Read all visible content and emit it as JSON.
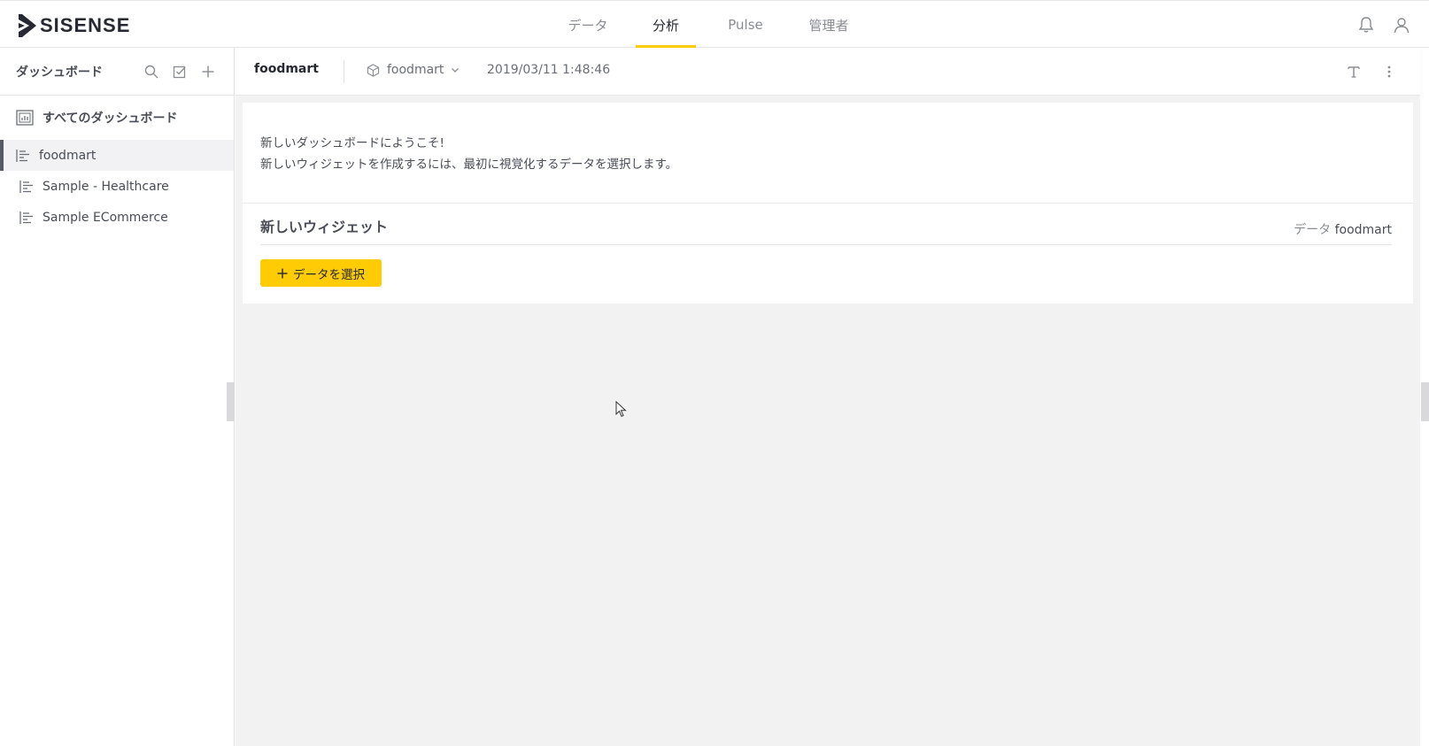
{
  "app": {
    "logo_text": "SISENSE"
  },
  "topnav": {
    "tabs": [
      {
        "label": "データ"
      },
      {
        "label": "分析",
        "active": true
      },
      {
        "label": "Pulse"
      },
      {
        "label": "管理者"
      }
    ]
  },
  "top_icons": [
    "bell-icon",
    "user-icon"
  ],
  "sidebar": {
    "title": "ダッシュボード",
    "tools": [
      "search-icon",
      "checklist-icon",
      "plus-icon"
    ],
    "all_label": "すべてのダッシュボード",
    "items": [
      {
        "label": "foodmart",
        "active": true
      },
      {
        "label": "Sample - Healthcare"
      },
      {
        "label": "Sample ECommerce"
      }
    ]
  },
  "dashboard": {
    "name": "foodmart",
    "source": "foodmart",
    "timestamp": "2019/03/11 1:48:46",
    "right_icons": [
      "text-icon",
      "more-icon"
    ]
  },
  "welcome": {
    "line1": "新しいダッシュボードにようこそ!",
    "line2": "新しいウィジェットを作成するには、最初に視覚化するデータを選択します。"
  },
  "new_widget": {
    "title": "新しいウィジェット",
    "data_label": "データ",
    "data_value": "foodmart",
    "select_button": "データを選択"
  },
  "colors": {
    "accent": "#ffcb05",
    "text": "#4a4d57",
    "canvas_bg": "#f2f2f2"
  }
}
